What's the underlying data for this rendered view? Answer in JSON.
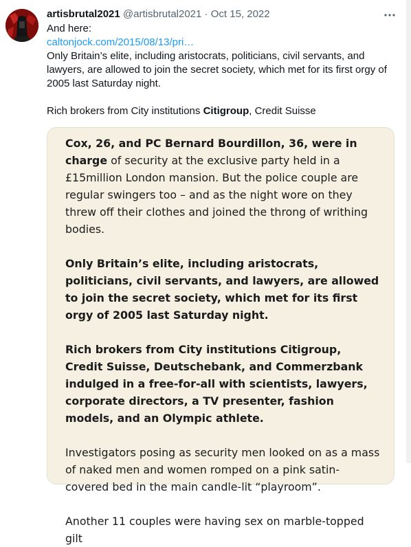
{
  "tweet": {
    "display_name": "artisbrutal2021",
    "handle": "@artisbrutal2021",
    "separator": "·",
    "date": "Oct 15, 2022",
    "lines": {
      "intro": "And here:",
      "link": "caltonjock.com/2015/08/13/pri…",
      "body": "Only Britain’s elite, including aristocrats, politicians, civil servants, and lawyers, are allowed to join the secret society, which met for its first orgy of 2005 last Saturday night.",
      "brokers_prefix": "Rich brokers from City institutions ",
      "brokers_bold": "Citigroup",
      "brokers_suffix": ", Credit Suisse"
    }
  },
  "quote": {
    "p1_bold": "Cox, 26, and PC Bernard Bourdillon, 36, were in charge",
    "p1_rest": " of security at the exclusive party held in a £15million London mansion. But the police couple are regular swingers too – and as the night wore on they threw off their clothes and joined the throng of writhing bodies.",
    "p2": "Only Britain’s elite, including aristocrats, politicians, civil servants, and lawyers, are allowed to join the secret society, which met for its first orgy of 2005 last Saturday night.",
    "p3": "Rich brokers from City institutions Citigroup, Credit Suisse, Deutschebank, and Commerzbank indulged in a free-for-all with scientists, lawyers, corporate directors, a TV presenter, fashion models, and an Olympic athlete.",
    "p4": "Investigators posing as security men looked on as a mass of naked men and women romped on a pink satin-covered bed in the main candle-lit “playroom”.",
    "p5": "Another 11 couples were having sex on marble-topped gilt"
  },
  "icons": {
    "more": "more-options-icon",
    "avatar": "avatar-image"
  }
}
